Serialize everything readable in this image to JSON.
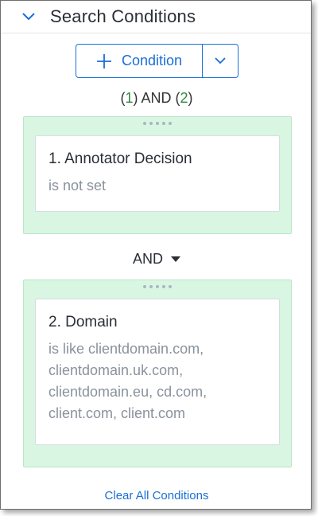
{
  "header": {
    "title": "Search Conditions",
    "collapse_icon": "chevron-down-icon"
  },
  "toolbar": {
    "add_label": "Condition",
    "add_icon": "plus-icon",
    "menu_icon": "chevron-down-icon"
  },
  "logic": {
    "open1": "(",
    "num1": "1",
    "close1": ")",
    "op": " AND ",
    "open2": "(",
    "num2": "2",
    "close2": ")"
  },
  "conditions": [
    {
      "title": "1. Annotator Decision",
      "description": "is not set"
    },
    {
      "title": "2. Domain",
      "description_lines": [
        "is like clientdomain.com,",
        "clientdomain.uk.com,",
        "clientdomain.eu, cd.com,",
        "client.com, client.com"
      ]
    }
  ],
  "operator": {
    "label": "AND",
    "icon": "caret-down-icon"
  },
  "footer": {
    "clear_label": "Clear All Conditions"
  },
  "colors": {
    "accent": "#1a6fd6",
    "group_bg": "#d9f6e2",
    "logic_number": "#2e8b3d"
  }
}
